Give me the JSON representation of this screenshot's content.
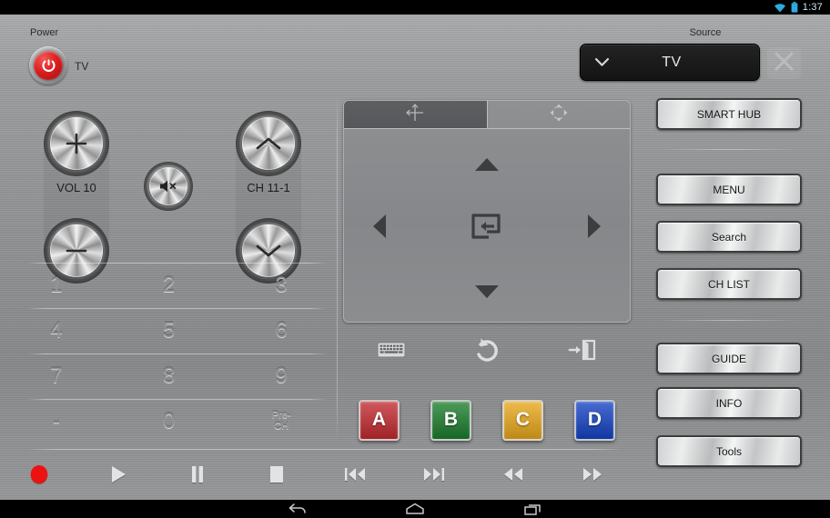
{
  "status_bar": {
    "clock": "1:37",
    "wifi_icon": "wifi-icon",
    "battery_icon": "battery-icon"
  },
  "header": {
    "power_label": "Power",
    "power_mode": "TV",
    "power_icon": "power-icon",
    "source_label": "Source",
    "source_value": "TV",
    "source_chevron_icon": "chevron-down-icon",
    "close_icon": "close-icon"
  },
  "left_panel": {
    "volume": {
      "label": "VOL 10",
      "up_icon": "plus-icon",
      "down_icon": "minus-icon"
    },
    "mute": {
      "icon": "mute-icon"
    },
    "channel": {
      "label": "CH 11-1",
      "up_icon": "chevron-up-icon",
      "down_icon": "chevron-down-icon"
    },
    "keypad": [
      [
        "1",
        "2",
        "3"
      ],
      [
        "4",
        "5",
        "6"
      ],
      [
        "7",
        "8",
        "9"
      ],
      [
        "-",
        "0",
        "Pre-\nCH"
      ]
    ],
    "keypad_flat": {
      "k1": "1",
      "k2": "2",
      "k3": "3",
      "k4": "4",
      "k5": "5",
      "k6": "6",
      "k7": "7",
      "k8": "8",
      "k9": "9",
      "kdash": "-",
      "k0": "0",
      "kprech_line1": "Pre-",
      "kprech_line2": "CH"
    }
  },
  "transport": {
    "buttons": [
      {
        "name": "record-button",
        "icon": "record-icon",
        "color": "#ee1111"
      },
      {
        "name": "play-button",
        "icon": "play-icon"
      },
      {
        "name": "pause-button",
        "icon": "pause-icon"
      },
      {
        "name": "stop-button",
        "icon": "stop-icon"
      },
      {
        "name": "previous-button",
        "icon": "skip-previous-icon"
      },
      {
        "name": "next-button",
        "icon": "skip-next-icon"
      },
      {
        "name": "rewind-button",
        "icon": "rewind-icon"
      },
      {
        "name": "fast-forward-button",
        "icon": "fast-forward-icon"
      }
    ]
  },
  "dpad_panel": {
    "tabs": [
      {
        "name": "touchpad-tab",
        "icon": "pointer-move-icon",
        "active": true
      },
      {
        "name": "dpad-tab",
        "icon": "four-way-arrows-icon",
        "active": false
      }
    ],
    "nav": {
      "up_icon": "triangle-up-icon",
      "down_icon": "triangle-down-icon",
      "left_icon": "triangle-left-icon",
      "right_icon": "triangle-right-icon",
      "enter_icon": "enter-icon"
    }
  },
  "icon_row": [
    {
      "name": "keyboard-button",
      "icon": "keyboard-icon"
    },
    {
      "name": "return-button",
      "icon": "return-arrow-icon"
    },
    {
      "name": "exit-button",
      "icon": "exit-door-icon"
    }
  ],
  "color_buttons": [
    {
      "label": "A",
      "color": "#c22a2f"
    },
    {
      "label": "B",
      "color": "#1c7d2c"
    },
    {
      "label": "C",
      "color": "#e8a71b"
    },
    {
      "label": "D",
      "color": "#1442c4"
    }
  ],
  "right_panel": {
    "buttons": [
      {
        "label": "SMART HUB"
      },
      {
        "label": "MENU"
      },
      {
        "label": "Search"
      },
      {
        "label": "CH LIST"
      },
      {
        "label": "GUIDE"
      },
      {
        "label": "INFO"
      },
      {
        "label": "Tools"
      }
    ]
  },
  "android_nav": {
    "back_icon": "back-arrow-icon",
    "home_icon": "home-icon",
    "recents_icon": "recent-apps-icon"
  }
}
